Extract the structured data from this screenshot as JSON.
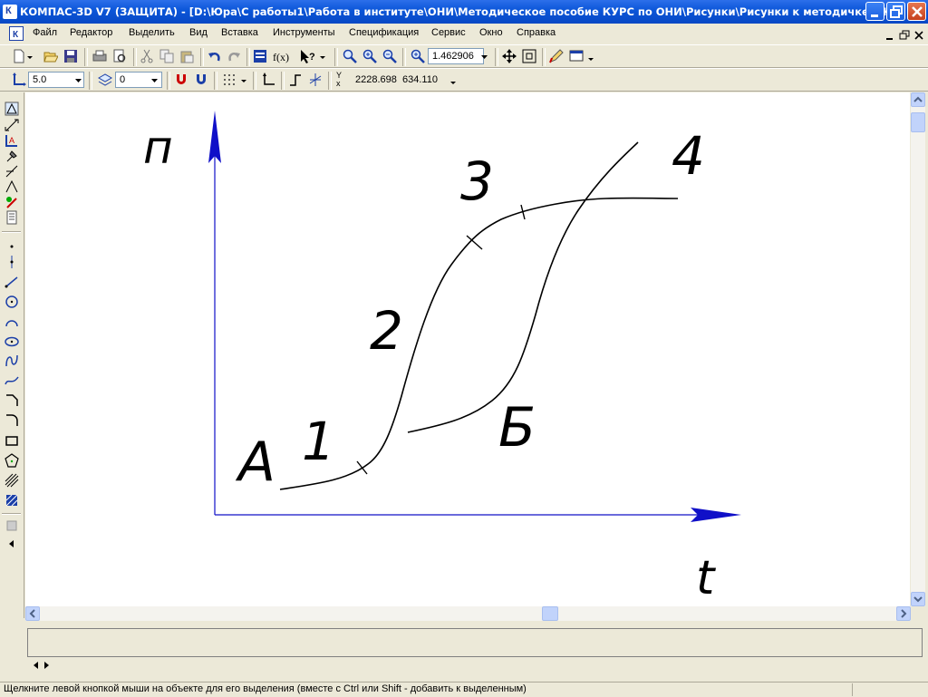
{
  "window": {
    "title": "КОМПАС-3D V7 (ЗАЩИТА) - [D:\\Юра\\С работы1\\Работа в институте\\ОНИ\\Методическое пособие КУРС по ОНИ\\Рисунки\\Рисунки к методичке в К...",
    "app_icon_letter": "К"
  },
  "menu": {
    "items": [
      "Файл",
      "Редактор",
      "Выделить",
      "Вид",
      "Вставка",
      "Инструменты",
      "Спецификация",
      "Сервис",
      "Окно",
      "Справка"
    ]
  },
  "toolbar1": {
    "zoom_value": "1.462906",
    "icons": [
      "new-doc-icon",
      "open-icon",
      "save-icon",
      "print-icon",
      "preview-icon",
      "cut-icon",
      "copy-icon",
      "paste-icon",
      "undo-icon",
      "redo-icon",
      "properties-icon",
      "fx-icon",
      "help-pointer-icon",
      "zoom-frame-icon",
      "zoom-in-icon",
      "zoom-out-icon",
      "zoom-scale-icon",
      "pan-icon",
      "fit-all-icon",
      "pencil-icon",
      "display-icon"
    ]
  },
  "toolbar2": {
    "step_value": "5.0",
    "layer_value": "0",
    "coord_label": "Y x",
    "coord_x": "2228.698",
    "coord_y": "634.110"
  },
  "left_toolbar": {
    "icons": [
      "geometry-icon",
      "dimensions-icon",
      "symbols-icon",
      "edit-icon",
      "parametrization-icon",
      "measure-icon",
      "select-icon",
      "spec-icon",
      "report-icon",
      "point-icon",
      "auxline-icon",
      "segment-icon",
      "circle-icon",
      "arc-icon",
      "ellipse-icon",
      "spline-icon",
      "polyline-icon",
      "chamfer-icon",
      "fillet-icon",
      "rectangle-icon",
      "polygon-icon",
      "hatch-icon",
      "fill-icon",
      "collapse-icon"
    ]
  },
  "drawing": {
    "y_axis_label": "п",
    "x_axis_label": "t",
    "labels": {
      "a": "А",
      "one": "1",
      "two": "2",
      "three": "3",
      "four": "4",
      "b": "Б"
    },
    "line_color": "#000000",
    "axis_color": "#1010C8"
  },
  "status": {
    "text": "Щелкните левой кнопкой мыши на объекте для его выделения (вместе с Ctrl или Shift - добавить к выделенным)"
  }
}
